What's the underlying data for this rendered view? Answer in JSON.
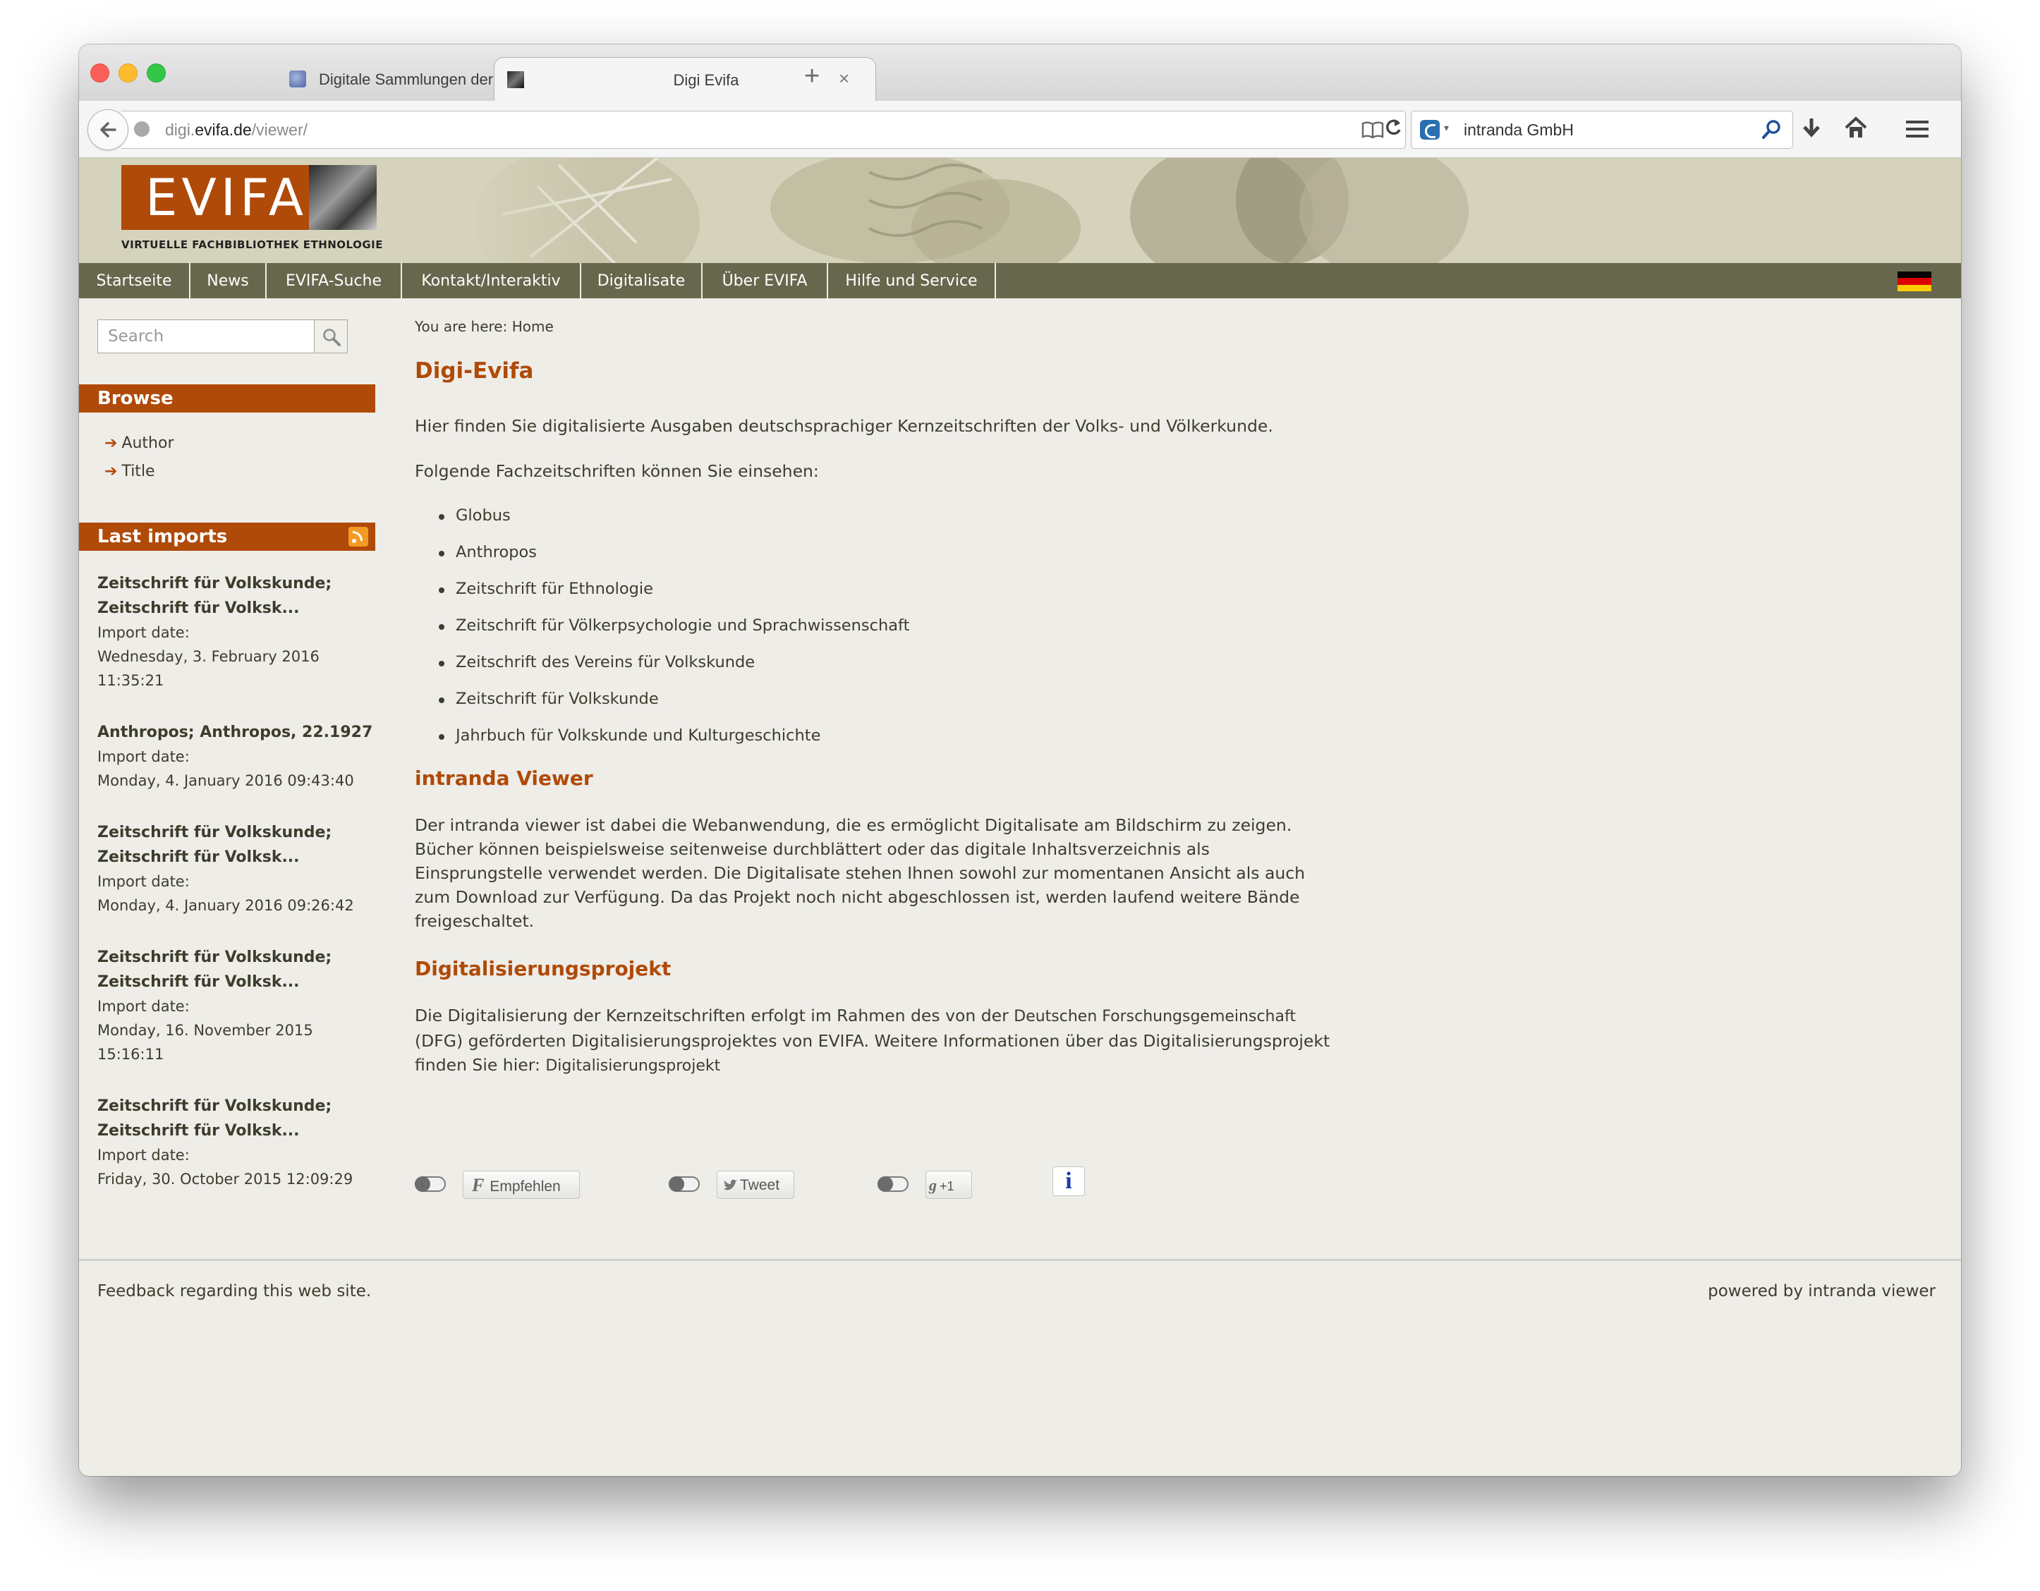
{
  "browser": {
    "tabs": [
      {
        "title": "Digitale Sammlungen der Univ...",
        "active": false,
        "icon": "globe-favicon-icon"
      },
      {
        "title": "Digi Evifa",
        "active": true,
        "icon": "evifa-favicon-icon"
      }
    ],
    "close_glyph": "×",
    "new_tab_glyph": "+",
    "url_prefix": "digi.",
    "url_domain": "evifa.de",
    "url_path": "/viewer/",
    "search_engine_text": "intranda GmbH"
  },
  "site": {
    "logo_text": "EVIFA",
    "logo_subtitle": "VIRTUELLE FACHBIBLIOTHEK ETHNOLOGIE",
    "nav": [
      "Startseite",
      "News",
      "EVIFA-Suche",
      "Kontakt/Interaktiv",
      "Digitalisate",
      "Über EVIFA",
      "Hilfe und Service"
    ],
    "language_flag": "de-flag-icon",
    "colors": {
      "accent": "#b04a08",
      "nav_bg": "#67674d",
      "header_bg": "#d5d3bb",
      "page_bg": "#eeede8"
    }
  },
  "sidebar": {
    "search_placeholder": "Search",
    "browse_heading": "Browse",
    "browse_links": [
      "Author",
      "Title"
    ],
    "browse_arrow": "➔",
    "last_imports_heading": "Last imports",
    "imports": [
      {
        "title_lines": [
          "Zeitschrift für Volkskunde;",
          "Zeitschrift für Volksk..."
        ],
        "label": "Import date:",
        "date_lines": [
          "Wednesday, 3. February 2016",
          "11:35:21"
        ]
      },
      {
        "title_lines": [
          "Anthropos; Anthropos, 22.1927"
        ],
        "label": "Import date:",
        "date_lines": [
          "Monday, 4. January 2016 09:43:40"
        ]
      },
      {
        "title_lines": [
          "Zeitschrift für Volkskunde;",
          "Zeitschrift für Volksk..."
        ],
        "label": "Import date:",
        "date_lines": [
          "Monday, 4. January 2016 09:26:42"
        ]
      },
      {
        "title_lines": [
          "Zeitschrift für Volkskunde;",
          "Zeitschrift für Volksk..."
        ],
        "label": "Import date:",
        "date_lines": [
          "Monday, 16. November 2015",
          "15:16:11"
        ]
      },
      {
        "title_lines": [
          "Zeitschrift für Volkskunde;",
          "Zeitschrift für Volksk..."
        ],
        "label": "Import date:",
        "date_lines": [
          "Friday, 30. October 2015 12:09:29"
        ]
      }
    ]
  },
  "main": {
    "breadcrumb": "You are here: Home",
    "title": "Digi-Evifa",
    "intro": "Hier finden Sie digitalisierte Ausgaben deutschsprachiger Kernzeitschriften der Volks- und Völkerkunde.",
    "list_intro": "Folgende Fachzeitschriften können Sie einsehen:",
    "journals": [
      "Globus",
      "Anthropos",
      "Zeitschrift für Ethnologie",
      "Zeitschrift für Völkerpsychologie und Sprachwissenschaft",
      "Zeitschrift des Vereins für Volkskunde",
      "Zeitschrift für Volkskunde",
      "Jahrbuch für Volkskunde und Kulturgeschichte"
    ],
    "viewer_heading": "intranda Viewer",
    "viewer_text": "Der intranda viewer ist dabei die Webanwendung, die es ermöglicht Digitalisate am Bildschirm zu zeigen. Bücher können beispielsweise seitenweise durchblättert oder das digitale Inhaltsverzeichnis als Einsprungstelle verwendet werden. Die Digitalisate stehen Ihnen sowohl zur momentanen Ansicht als auch zum Download zur Verfügung. Da das Projekt noch nicht abgeschlossen ist, werden laufend weitere Bände freigeschaltet.",
    "project_heading": "Digitalisierungsprojekt",
    "project_text_1": "Die Digitalisierung der Kernzeitschriften erfolgt im Rahmen des von der ",
    "project_link_1": "Deutschen Forschungsgemeinschaft",
    "project_text_2": " (DFG) geförderten Digitalisierungsprojektes von EVIFA. Weitere Informationen über das Digitalisierungsprojekt finden Sie hier: ",
    "project_link_2": "Digitalisierungsprojekt",
    "social": {
      "facebook_label": "Empfehlen",
      "facebook_glyph": "F",
      "twitter_label": "Tweet",
      "gplus_label": "+1",
      "gplus_glyph": "g",
      "info_glyph": "i"
    }
  },
  "footer": {
    "left": "Feedback regarding this web site.",
    "right": "powered by intranda viewer"
  }
}
